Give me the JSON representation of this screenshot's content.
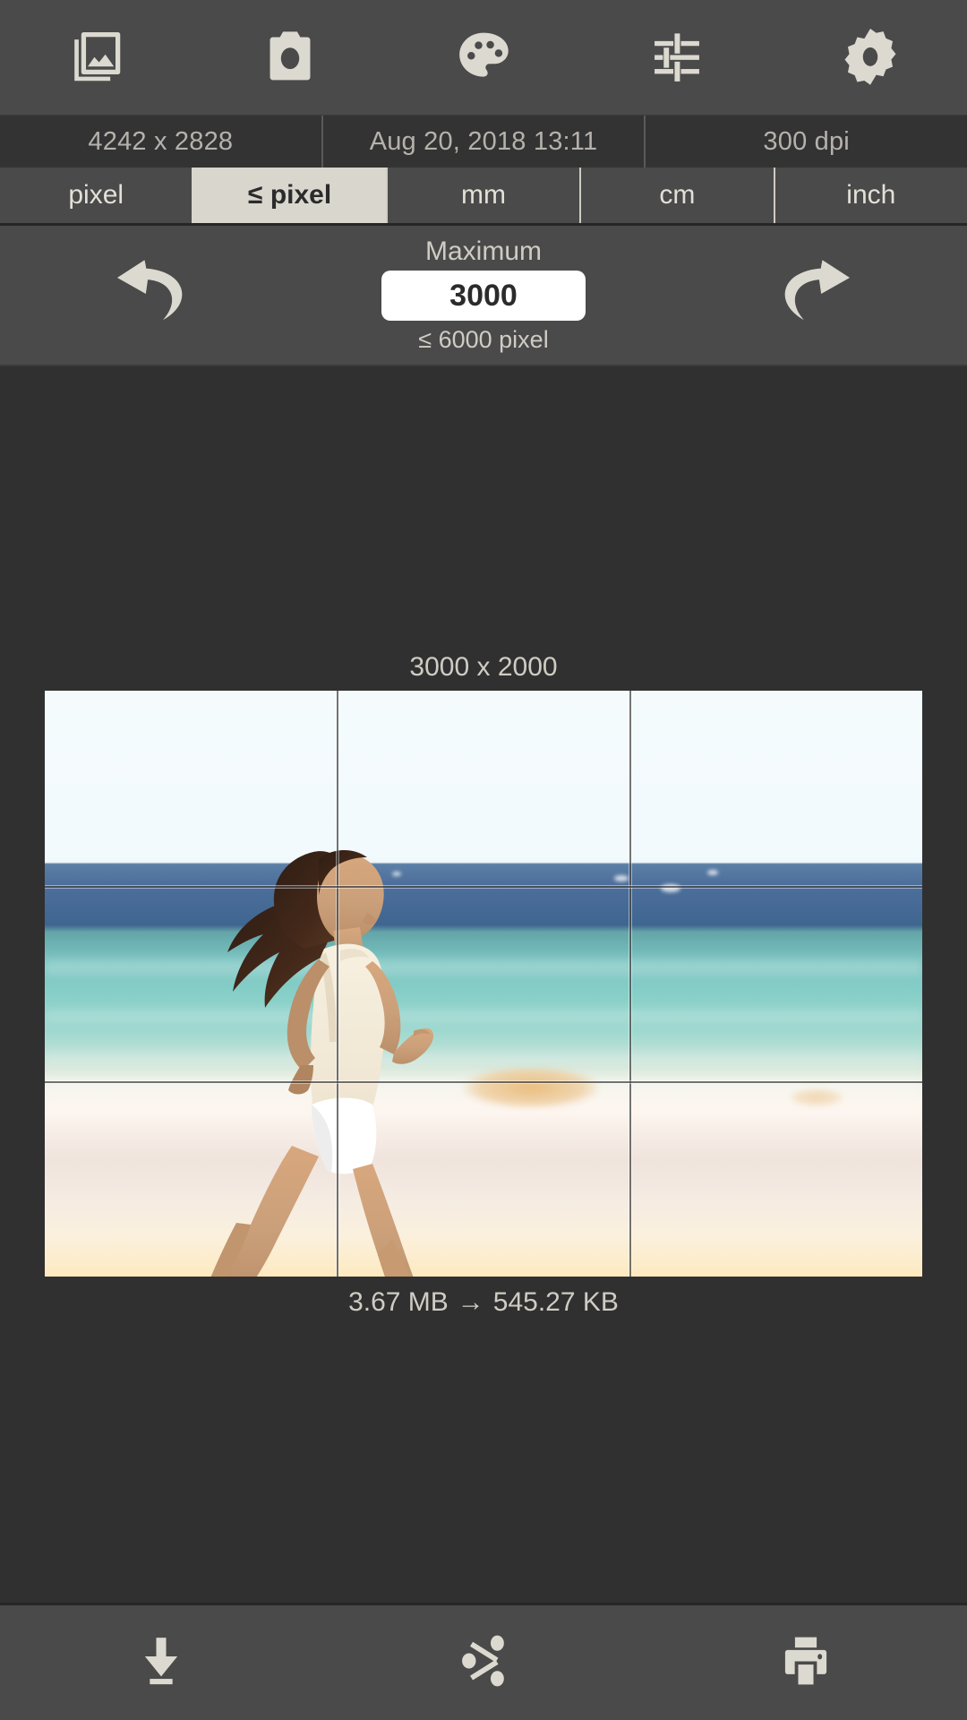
{
  "top_toolbar": {
    "items": [
      {
        "name": "gallery-icon",
        "label": "Gallery"
      },
      {
        "name": "camera-icon",
        "label": "Camera"
      },
      {
        "name": "palette-icon",
        "label": "Palette"
      },
      {
        "name": "sliders-icon",
        "label": "Adjustments"
      },
      {
        "name": "gear-icon",
        "label": "Settings"
      }
    ]
  },
  "info": {
    "dimensions": "4242 x 2828",
    "date": "Aug 20, 2018 13:11",
    "dpi": "300 dpi"
  },
  "unit_tabs": {
    "items": [
      {
        "label": "pixel",
        "selected": false
      },
      {
        "label": "≤ pixel",
        "selected": true
      },
      {
        "label": "mm",
        "selected": false
      },
      {
        "label": "cm",
        "selected": false
      },
      {
        "label": "inch",
        "selected": false
      }
    ],
    "selected_label": "≤ pixel"
  },
  "maximum": {
    "label": "Maximum",
    "value": "3000",
    "placeholder": "3000",
    "hint": "≤ 6000 pixel",
    "undo_label": "Undo",
    "redo_label": "Redo"
  },
  "preview": {
    "output_dimensions": "3000 x 2000",
    "size_before": "3.67 MB",
    "size_arrow": "→",
    "size_after": "545.27 KB",
    "image_description": "Woman jogging on a tropical beach with turquoise ocean"
  },
  "bottom_toolbar": {
    "items": [
      {
        "name": "download-icon",
        "label": "Save"
      },
      {
        "name": "share-icon",
        "label": "Share"
      },
      {
        "name": "print-icon",
        "label": "Print"
      }
    ]
  },
  "colors": {
    "toolbar_bg": "#4a4a4a",
    "info_bg": "#333333",
    "canvas_bg": "#303030",
    "icon": "#dcd9d0",
    "text_muted": "#cfccc4",
    "tab_selected_bg": "#d9d6cd",
    "input_bg": "#ffffff"
  }
}
